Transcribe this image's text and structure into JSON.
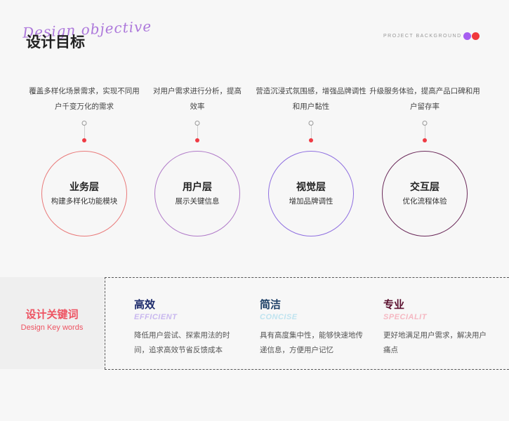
{
  "header": {
    "script_title": "Design objective",
    "title": "设计目标",
    "project_label": "PROJECT BACKGROUND",
    "dot_colors": [
      "#a65ef0",
      "#f0383c"
    ]
  },
  "layers": [
    {
      "desc": "覆盖多样化场景需求，实现不同用户千变万化的需求",
      "title": "业务层",
      "subtitle": "构建多样化功能模块",
      "color": "#e97a7a"
    },
    {
      "desc": "对用户需求进行分析，提高效率",
      "title": "用户层",
      "subtitle": "展示关键信息",
      "color": "#b07ac8"
    },
    {
      "desc": "营造沉浸式氛围感，增强品牌调性和用户黏性",
      "title": "视觉层",
      "subtitle": "增加品牌调性",
      "color": "#8f6fe0"
    },
    {
      "desc": "升级服务体验，提高产品口碑和用户留存率",
      "title": "交互层",
      "subtitle": "优化流程体验",
      "color": "#6b2a5a"
    }
  ],
  "keywords_section": {
    "title": "设计关键词",
    "subtitle": "Design Key words",
    "items": [
      {
        "title": "高效",
        "en": "EFFICIENT",
        "desc": "降低用户尝试、探索用法的时间，追求高效节省反馈成本",
        "title_color": "#1c2a6b",
        "en_color": "#c9b8ef"
      },
      {
        "title": "简洁",
        "en": "CONCISE",
        "desc": "具有高度集中性，能够快速地传递信息，方便用户记忆",
        "title_color": "#1c3f66",
        "en_color": "#bfe3ef"
      },
      {
        "title": "专业",
        "en": "SPECIALIT",
        "desc": "更好地满足用户需求，解决用户痛点",
        "title_color": "#5a0f2e",
        "en_color": "#f5b8c2"
      }
    ]
  }
}
